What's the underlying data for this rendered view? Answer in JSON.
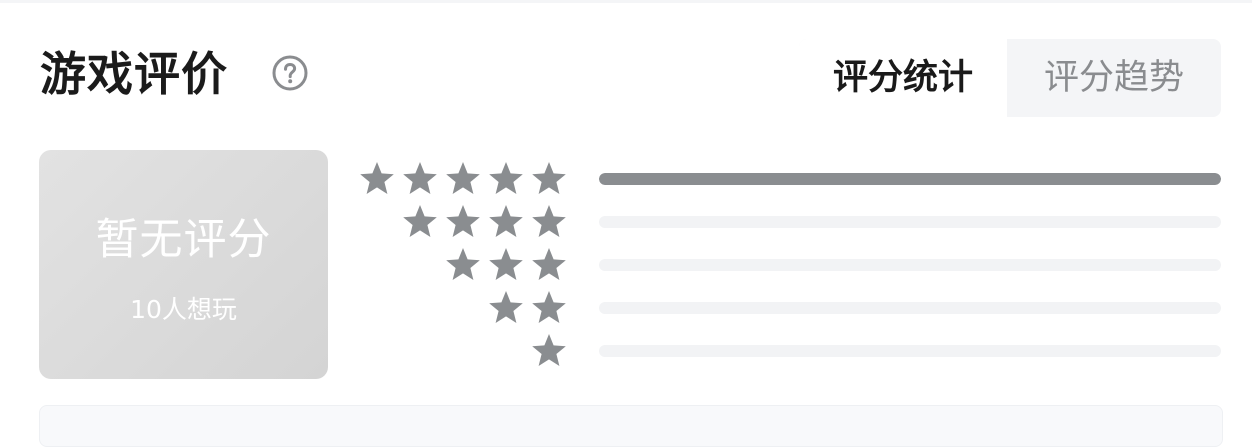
{
  "section": {
    "title": "游戏评价"
  },
  "icons": {
    "help": "question-circle-icon",
    "star": "star-icon"
  },
  "tabs": [
    {
      "label": "评分统计",
      "active": true
    },
    {
      "label": "评分趋势",
      "active": false
    }
  ],
  "score_card": {
    "score_text": "暂无评分",
    "want_play_text": "10人想玩"
  },
  "rating_distribution": [
    {
      "stars": 5,
      "fraction": 1.0
    },
    {
      "stars": 4,
      "fraction": 0.0
    },
    {
      "stars": 3,
      "fraction": 0.0
    },
    {
      "stars": 2,
      "fraction": 0.0
    },
    {
      "stars": 1,
      "fraction": 0.0
    }
  ],
  "colors": {
    "star": "#8a8d90",
    "bar_fill": "#8a8d90",
    "bar_track": "#f2f3f5",
    "card_bg": "#d9d9d9",
    "tab_bg": "#f4f5f7"
  }
}
